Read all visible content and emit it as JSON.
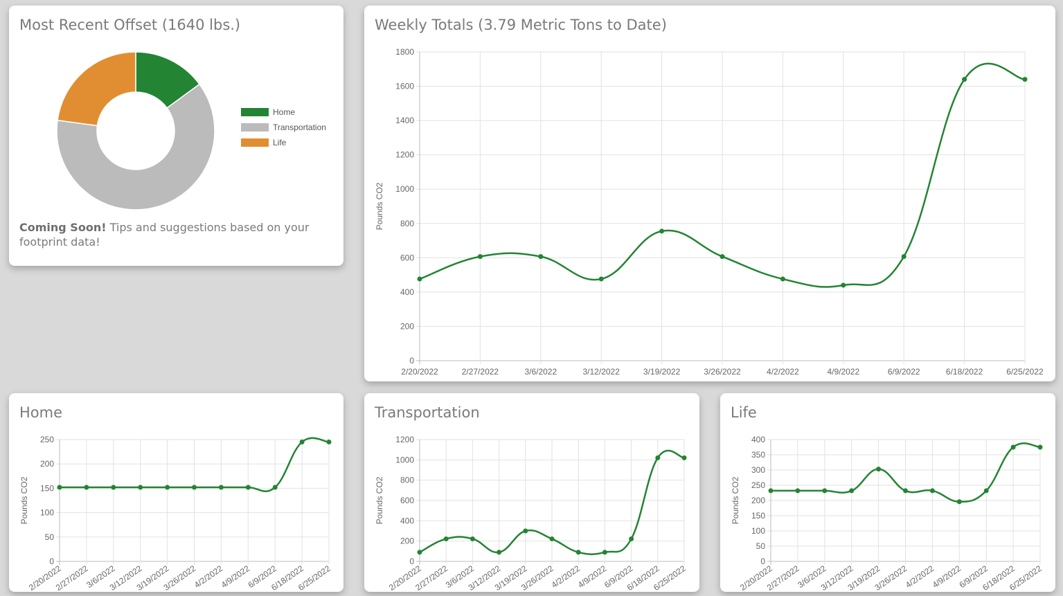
{
  "cards": {
    "donut": {
      "title": "Most Recent Offset (1640 lbs.)"
    },
    "weekly": {
      "title": "Weekly Totals (3.79 Metric Tons to Date)"
    },
    "home": {
      "title": "Home"
    },
    "transport": {
      "title": "Transportation"
    },
    "life": {
      "title": "Life"
    }
  },
  "tips": {
    "bold": "Coming Soon!",
    "text": " Tips and suggestions based on your footprint data!"
  },
  "colors": {
    "line": "#238433",
    "home": "#238433",
    "transportation": "#bbbbbb",
    "life": "#e08e31",
    "grid": "#e2e2e2",
    "axis": "#666666"
  },
  "chart_data": [
    {
      "id": "donut",
      "type": "pie",
      "labels": [
        "Home",
        "Transportation",
        "Life"
      ],
      "values": [
        245,
        1020,
        375
      ],
      "colors": [
        "#238433",
        "#bbbbbb",
        "#e08e31"
      ]
    },
    {
      "id": "weekly",
      "type": "line",
      "categories": [
        "2/20/2022",
        "2/27/2022",
        "3/6/2022",
        "3/12/2022",
        "3/19/2022",
        "3/26/2022",
        "4/2/2022",
        "4/9/2022",
        "6/9/2022",
        "6/18/2022",
        "6/25/2022"
      ],
      "values": [
        476,
        607,
        607,
        476,
        755,
        607,
        476,
        440,
        607,
        1640,
        1640
      ],
      "ylabel": "Pounds CO2",
      "ylim": [
        0,
        1800
      ],
      "yticks": [
        0,
        200,
        400,
        600,
        800,
        1000,
        1200,
        1400,
        1600,
        1800
      ]
    },
    {
      "id": "home",
      "type": "line",
      "categories": [
        "2/20/2022",
        "2/27/2022",
        "3/6/2022",
        "3/12/2022",
        "3/19/2022",
        "3/26/2022",
        "4/2/2022",
        "4/9/2022",
        "6/9/2022",
        "6/18/2022",
        "6/25/2022"
      ],
      "values": [
        152,
        152,
        152,
        152,
        152,
        152,
        152,
        152,
        152,
        245,
        245
      ],
      "ylabel": "Pounds CO2",
      "ylim": [
        0,
        250
      ],
      "yticks": [
        0,
        50,
        100,
        150,
        200,
        250
      ]
    },
    {
      "id": "transport",
      "type": "line",
      "categories": [
        "2/20/2022",
        "2/27/2022",
        "3/6/2022",
        "3/12/2022",
        "3/19/2022",
        "3/26/2022",
        "4/2/2022",
        "4/9/2022",
        "6/9/2022",
        "6/18/2022",
        "6/25/2022"
      ],
      "values": [
        90,
        222,
        222,
        90,
        300,
        222,
        90,
        90,
        222,
        1020,
        1020
      ],
      "ylabel": "Pounds CO2",
      "ylim": [
        0,
        1200
      ],
      "yticks": [
        0,
        200,
        400,
        600,
        800,
        1000,
        1200
      ]
    },
    {
      "id": "life",
      "type": "line",
      "categories": [
        "2/20/2022",
        "2/27/2022",
        "3/6/2022",
        "3/12/2022",
        "3/19/2022",
        "3/26/2022",
        "4/2/2022",
        "4/9/2022",
        "6/9/2022",
        "6/18/2022",
        "6/25/2022"
      ],
      "values": [
        232,
        232,
        232,
        232,
        303,
        232,
        232,
        196,
        232,
        375,
        375
      ],
      "ylabel": "Pounds CO2",
      "ylim": [
        0,
        400
      ],
      "yticks": [
        0,
        50,
        100,
        150,
        200,
        250,
        300,
        350,
        400
      ]
    }
  ]
}
